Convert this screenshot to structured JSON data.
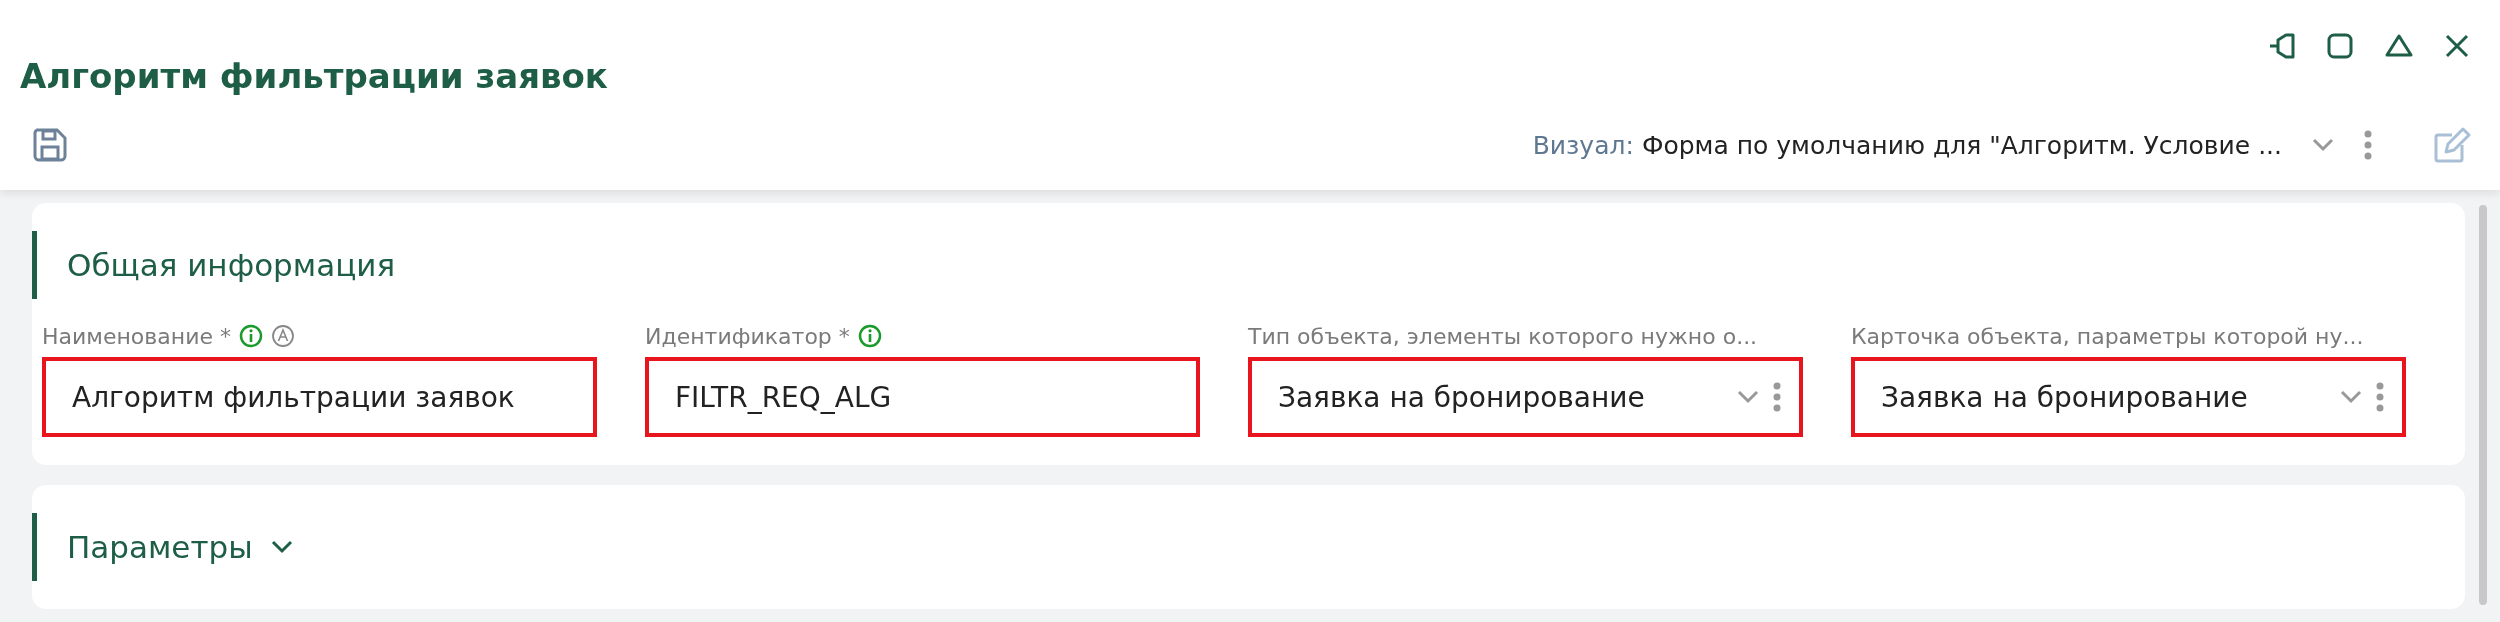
{
  "window": {
    "title": "Алгоритм фильтрации заявок"
  },
  "toolbar": {
    "visual_label": "Визуал:",
    "visual_value": "Форма по умолчанию для \"Алгоритм. Условие ..."
  },
  "sections": [
    {
      "title": "Общая информация",
      "kind": "fields",
      "fields": [
        {
          "kind": "text",
          "label": "Наименование *",
          "value": "Алгоритм фильтрации заявок",
          "info": true,
          "auto": true,
          "highlighted": true
        },
        {
          "kind": "text",
          "label": "Идентификатор *",
          "value": "FILTR_REQ_ALG",
          "info": true,
          "auto": false,
          "highlighted": true
        },
        {
          "kind": "select",
          "label": "Тип объекта, элементы которого нужно о...",
          "value": "Заявка на бронирование",
          "info": false,
          "auto": false,
          "highlighted": true
        },
        {
          "kind": "select",
          "label": "Карточка объекта, параметры которой ну...",
          "value": "Заявка на бронирование",
          "info": false,
          "auto": false,
          "highlighted": true
        }
      ]
    },
    {
      "title": "Параметры",
      "kind": "collapsible",
      "expanded": false
    }
  ]
}
